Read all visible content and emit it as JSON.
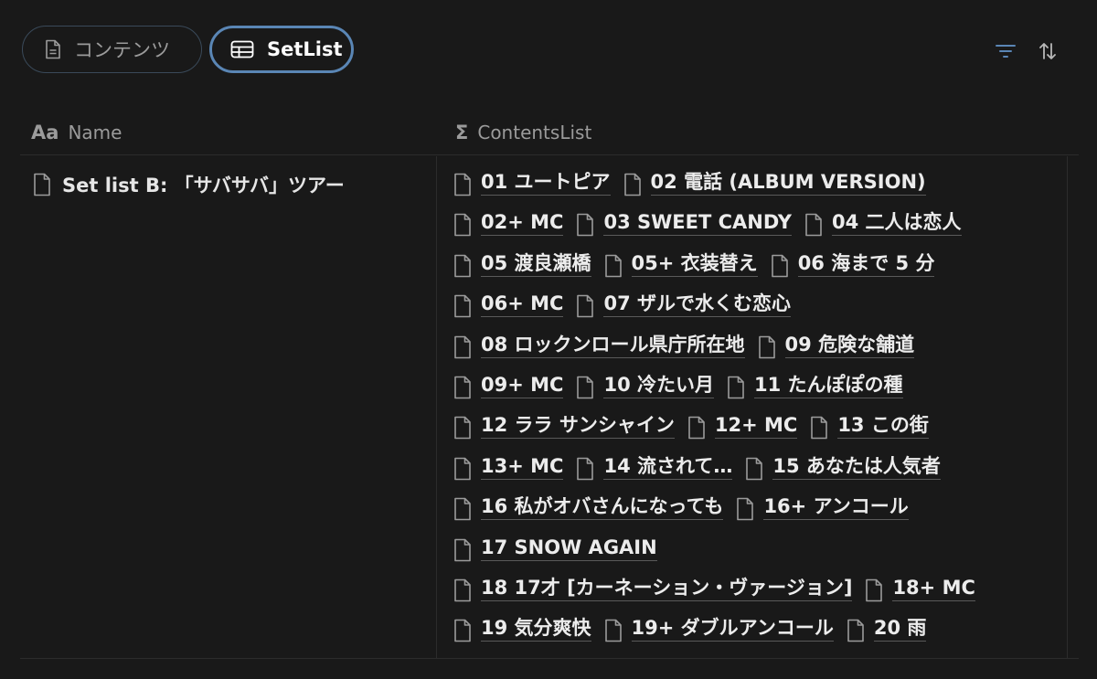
{
  "tabs": [
    {
      "label": "コンテンツ",
      "icon": "document-icon",
      "active": false
    },
    {
      "label": "SetList",
      "icon": "table-icon",
      "active": true
    }
  ],
  "toolbar": {
    "filter_icon": "filter-icon",
    "sort_icon": "sort-icon",
    "accent": "#5a86b5"
  },
  "columns": {
    "name": "Name",
    "contents": "ContentsList"
  },
  "row": {
    "name": "Set list B: 「サバサバ」ツアー",
    "lines": [
      [
        "01 ユートピア",
        "02 電話 (ALBUM VERSION)"
      ],
      [
        "02+ MC",
        "03 SWEET CANDY",
        "04 二人は恋人"
      ],
      [
        "05 渡良瀬橋",
        "05+ 衣装替え",
        "06 海まで 5 分"
      ],
      [
        "06+ MC",
        "07 ザルで水くむ恋心"
      ],
      [
        "08 ロックンロール県庁所在地",
        "09 危険な舗道"
      ],
      [
        "09+ MC",
        "10 冷たい月",
        "11 たんぽぽの種"
      ],
      [
        "12 ララ サンシャイン",
        "12+ MC",
        "13 この街"
      ],
      [
        "13+ MC",
        "14 流されて…",
        "15 あなたは人気者"
      ],
      [
        "16 私がオバさんになっても",
        "16+ アンコール"
      ],
      [
        "17 SNOW AGAIN"
      ],
      [
        "18 17才 [カーネーション・ヴァージョン]",
        "18+ MC"
      ],
      [
        "19 気分爽快",
        "19+ ダブルアンコール",
        "20 雨"
      ]
    ]
  }
}
